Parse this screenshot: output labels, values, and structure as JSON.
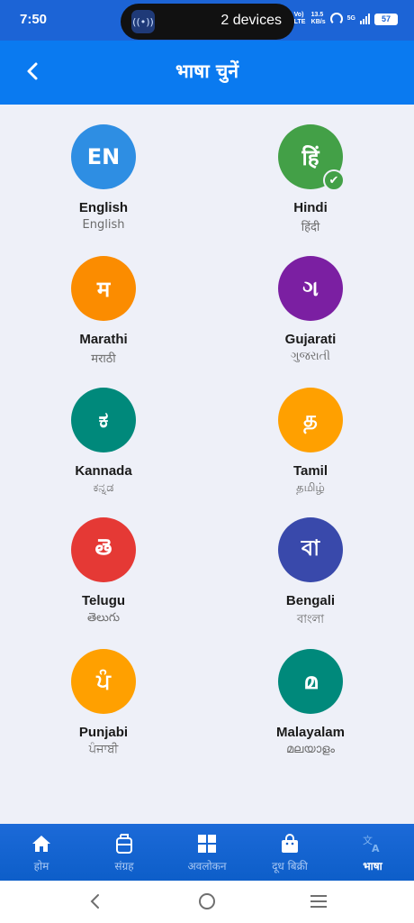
{
  "status_bar": {
    "time": "7:50",
    "island_text": "2 devices",
    "net_type": "Vo) LTE",
    "speed": "13.5 KB/s",
    "signal": "5G",
    "battery": "57"
  },
  "header": {
    "title": "भाषा चुनें"
  },
  "languages": [
    {
      "symbol": "EN",
      "name": "English",
      "native": "English",
      "color": "#2e8ee3",
      "selected": false
    },
    {
      "symbol": "हिं",
      "name": "Hindi",
      "native": "हिंदी",
      "color": "#43a047",
      "selected": true
    },
    {
      "symbol": "म",
      "name": "Marathi",
      "native": "मराठी",
      "color": "#fb8c00",
      "selected": false
    },
    {
      "symbol": "ગ",
      "name": "Gujarati",
      "native": "ગુજરાતી",
      "color": "#7b1fa2",
      "selected": false
    },
    {
      "symbol": "ಕ",
      "name": "Kannada",
      "native": "ಕನ್ನಡ",
      "color": "#00897b",
      "selected": false
    },
    {
      "symbol": "த",
      "name": "Tamil",
      "native": "தமிழ்",
      "color": "#ffa000",
      "selected": false
    },
    {
      "symbol": "తె",
      "name": "Telugu",
      "native": "తెలుగు",
      "color": "#e53935",
      "selected": false
    },
    {
      "symbol": "বা",
      "name": "Bengali",
      "native": "বাংলা",
      "color": "#3949ab",
      "selected": false
    },
    {
      "symbol": "ਪੰ",
      "name": "Punjabi",
      "native": "ਪੰਜਾਬੀ",
      "color": "#ffa000",
      "selected": false
    },
    {
      "symbol": "മ",
      "name": "Malayalam",
      "native": "മലയാളം",
      "color": "#00897b",
      "selected": false
    }
  ],
  "bottom_nav": {
    "items": [
      {
        "label": "होम",
        "icon": "home-icon"
      },
      {
        "label": "संग्रह",
        "icon": "collection-icon"
      },
      {
        "label": "अवलोकन",
        "icon": "overview-icon"
      },
      {
        "label": "दूध बिक्री",
        "icon": "milk-sale-icon"
      },
      {
        "label": "भाषा",
        "icon": "language-icon",
        "active": true
      }
    ]
  }
}
